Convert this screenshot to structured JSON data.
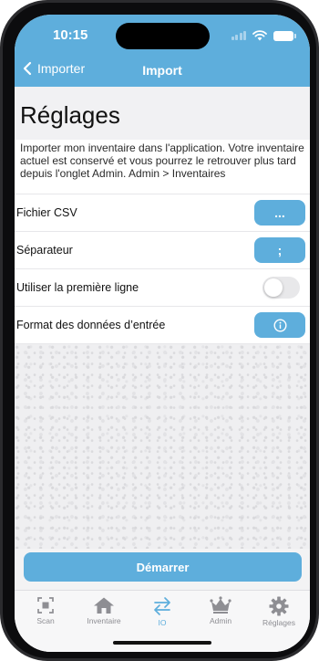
{
  "status_bar": {
    "time": "10:15"
  },
  "nav": {
    "back_label": "Importer",
    "title": "Import"
  },
  "page": {
    "title": "Réglages",
    "description": "Importer mon inventaire dans l'application. Votre inventaire actuel est conservé et vous pourrez le retrouver plus tard depuis l'onglet Admin. Admin > Inventaires"
  },
  "settings": {
    "csv_label": "Fichier CSV",
    "csv_button": "...",
    "separator_label": "Séparateur",
    "separator_value": ";",
    "first_line_label": "Utiliser la première ligne",
    "first_line_enabled": false,
    "format_label": "Format des données d’entrée"
  },
  "start_button": "Démarrer",
  "tabs": [
    {
      "label": "Scan",
      "icon": "scan-icon",
      "active": false
    },
    {
      "label": "Inventaire",
      "icon": "home-icon",
      "active": false
    },
    {
      "label": "IO",
      "icon": "transfer-arrows-icon",
      "active": true
    },
    {
      "label": "Admin",
      "icon": "crown-icon",
      "active": false
    },
    {
      "label": "Réglages",
      "icon": "gear-icon",
      "active": false
    }
  ],
  "colors": {
    "accent": "#5eaedc",
    "inactive": "#8e8e93"
  }
}
